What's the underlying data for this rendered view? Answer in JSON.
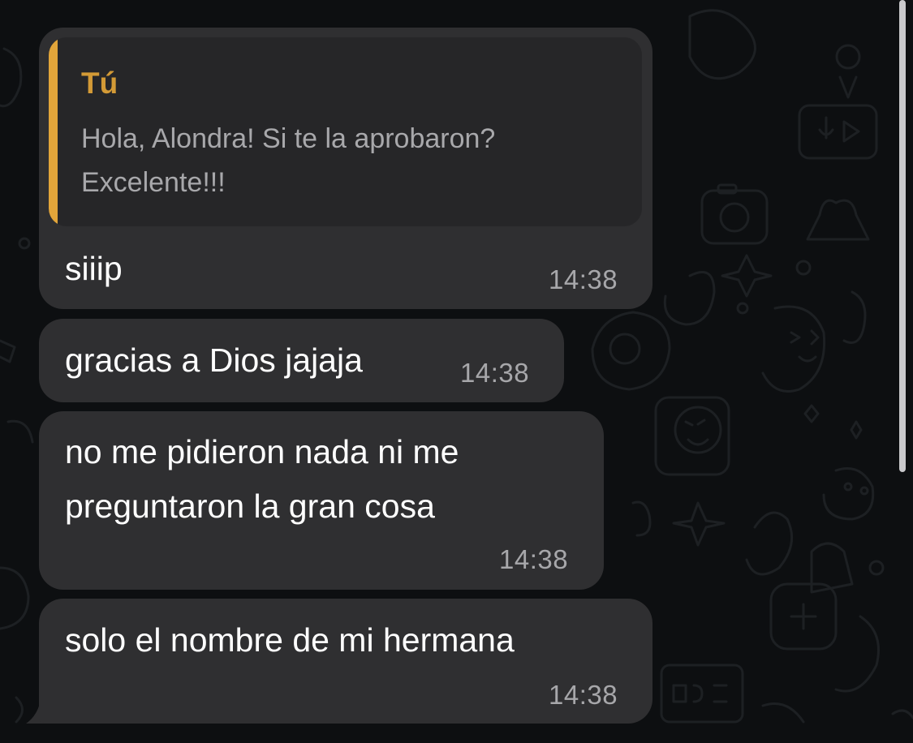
{
  "colors": {
    "background": "#0d0f11",
    "bubble": "#2f2f31",
    "quote_background": "#262628",
    "quote_accent": "#e2a53a",
    "quote_author": "#d39a36",
    "text": "#ffffff",
    "timestamp": "#a7a7aa"
  },
  "messages": [
    {
      "reply_to": {
        "author": "Tú",
        "text": "Hola, Alondra! Si te la aprobaron? Excelente!!!"
      },
      "text": "siiip",
      "time": "14:38"
    },
    {
      "text": "gracias a Dios jajaja",
      "time": "14:38"
    },
    {
      "text_lines": [
        "no me pidieron nada ni me",
        "preguntaron la gran cosa"
      ],
      "time": "14:38"
    },
    {
      "text": "solo el nombre de mi hermana",
      "time": "14:38"
    }
  ]
}
